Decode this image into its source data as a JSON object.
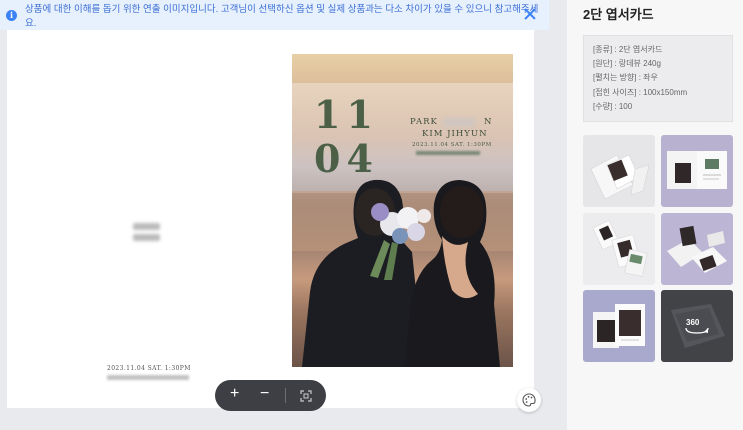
{
  "notice": {
    "text": "상품에 대한 이해를 돕기 위한 연출 이미지입니다. 고객님이 선택하신 옵션 및 실제 상품과는 다소 차이가 있을 수 있으니 참고해주세요."
  },
  "card": {
    "left_date": "2023.11.04 SAT. 1:30PM",
    "number_top": "11",
    "number_bottom": "04",
    "groom_name": "PARK",
    "groom_initial": "N",
    "bride_name": "KIM JIHYUN",
    "photo_date": "2023.11.04 SAT. 1:30PM"
  },
  "toolbar": {
    "zoom_in": "+",
    "zoom_out": "−"
  },
  "product": {
    "title": "2단 엽서카드",
    "specs": [
      "[종류] : 2단 엽서카드",
      "[원단] : 랑데뷰 240g",
      "[펼치는 방향] : 좌우",
      "[접힌 사이즈] : 100x150mm",
      "[수량] : 100"
    ],
    "thumb_360_label": "360"
  },
  "colors": {
    "accent": "#3b82f6",
    "notice_bg": "#e7f0fd",
    "card_green": "#4c6048",
    "toolbar_bg": "#3d3f44"
  }
}
